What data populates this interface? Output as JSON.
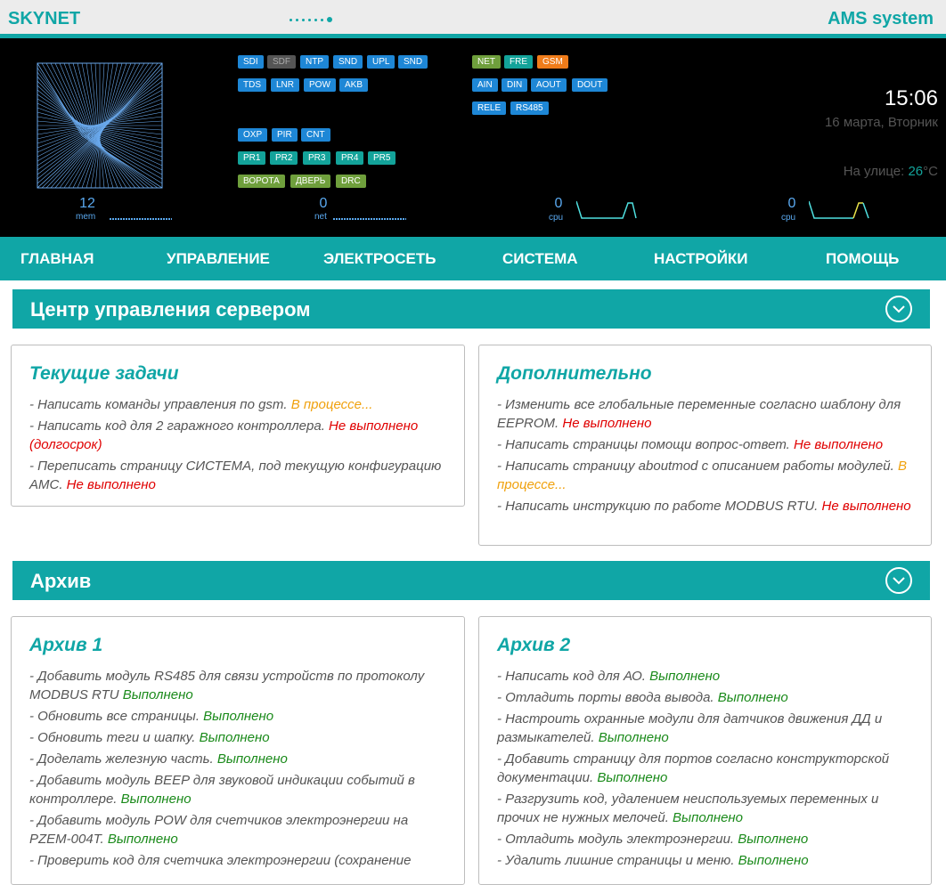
{
  "brand": "SKYNET",
  "system": "AMS system",
  "tags": {
    "row1a": [
      "SDI",
      "SDF",
      "NTP",
      "SND",
      "UPL",
      "SND"
    ],
    "row1b": [
      "NET",
      "FRE",
      "GSM"
    ],
    "row2a": [
      "TDS",
      "LNR",
      "POW",
      "AKB"
    ],
    "row2b": [
      "AIN",
      "DIN",
      "AOUT",
      "DOUT"
    ],
    "row3b": [
      "RELE",
      "RS485"
    ],
    "row4a": [
      "OXP",
      "PIR",
      "CNT"
    ],
    "row5a": [
      "PR1",
      "PR2",
      "PR3",
      "PR4",
      "PR5"
    ],
    "row6a": [
      "ВОРОТА",
      "ДВЕРЬ",
      "DRC"
    ]
  },
  "clock": "15:06",
  "date": "16 марта, Вторник",
  "outside_label": "На улице: ",
  "outside_temp": "26",
  "outside_unit": "°C",
  "stats": {
    "mem": {
      "value": "12",
      "label": "mem"
    },
    "net": {
      "value": "0",
      "label": "net"
    },
    "cpu1": {
      "value": "0",
      "label": "cpu"
    },
    "cpu2": {
      "value": "0",
      "label": "cpu"
    }
  },
  "nav": [
    "ГЛАВНАЯ",
    "УПРАВЛЕНИЕ",
    "ЭЛЕКТРОСЕТЬ",
    "СИСТЕМА",
    "НАСТРОЙКИ",
    "ПОМОЩЬ"
  ],
  "sections": {
    "server": "Центр управления сервером",
    "archive": "Архив"
  },
  "cards": {
    "current": {
      "title": "Текущие задачи",
      "items": [
        {
          "text": "- Написать команды управления по gsm. ",
          "status": "В процессе...",
          "type": "w"
        },
        {
          "text": "- Написать код для 2 гаражного контроллера. ",
          "status": "Не выполнено (долгосрок)",
          "type": "n"
        },
        {
          "text": "- Переписать страницу СИСТЕМА, под текущую конфигурацию АМС. ",
          "status": "Не выполнено",
          "type": "n"
        }
      ]
    },
    "extra": {
      "title": "Дополнительно",
      "items": [
        {
          "text": "- Изменить все глобальные переменные согласно шаблону для EEPROM. ",
          "status": "Не выполнено",
          "type": "n"
        },
        {
          "text": "- Написать страницы помощи вопрос-ответ. ",
          "status": "Не выполнено",
          "type": "n"
        },
        {
          "text": "- Написать страницу aboutmod с описанием работы модулей. ",
          "status": "В процессе...",
          "type": "w"
        },
        {
          "text": "- Написать инструкцию по работе MODBUS RTU. ",
          "status": "Не выполнено",
          "type": "n"
        }
      ]
    },
    "archive1": {
      "title": "Архив 1",
      "items": [
        {
          "text": "- Добавить модуль RS485 для связи устройств по протоколу MODBUS RTU ",
          "status": "Выполнено",
          "type": "d"
        },
        {
          "text": "- Обновить все страницы. ",
          "status": "Выполнено",
          "type": "d"
        },
        {
          "text": "- Обновить теги и шапку. ",
          "status": "Выполнено",
          "type": "d"
        },
        {
          "text": "- Доделать железную часть. ",
          "status": "Выполнено",
          "type": "d"
        },
        {
          "text": "- Добавить модуль BEEP для звуковой индикации событий в контроллере. ",
          "status": "Выполнено",
          "type": "d"
        },
        {
          "text": "- Добавить модуль POW для счетчиков электроэнергии на PZEM-004T. ",
          "status": "Выполнено",
          "type": "d"
        },
        {
          "text": "- Проверить код для счетчика электроэнергии (сохранение",
          "status": "",
          "type": "d"
        }
      ]
    },
    "archive2": {
      "title": "Архив 2",
      "items": [
        {
          "text": "- Написать код для АО. ",
          "status": "Выполнено",
          "type": "d"
        },
        {
          "text": "- Отладить порты ввода вывода. ",
          "status": "Выполнено",
          "type": "d"
        },
        {
          "text": "- Настроить охранные модули для датчиков движения ДД и размыкателей. ",
          "status": "Выполнено",
          "type": "d"
        },
        {
          "text": "- Добавить страницу для портов согласно конструкторской документации. ",
          "status": "Выполнено",
          "type": "d"
        },
        {
          "text": "- Разгрузить код, удалением неиспользуемых переменных и прочих не нужных мелочей. ",
          "status": "Выполнено",
          "type": "d"
        },
        {
          "text": "- Отладить модуль электроэнергии. ",
          "status": "Выполнено",
          "type": "d"
        },
        {
          "text": "- Удалить лишние страницы и меню. ",
          "status": "Выполнено",
          "type": "d"
        }
      ]
    }
  }
}
